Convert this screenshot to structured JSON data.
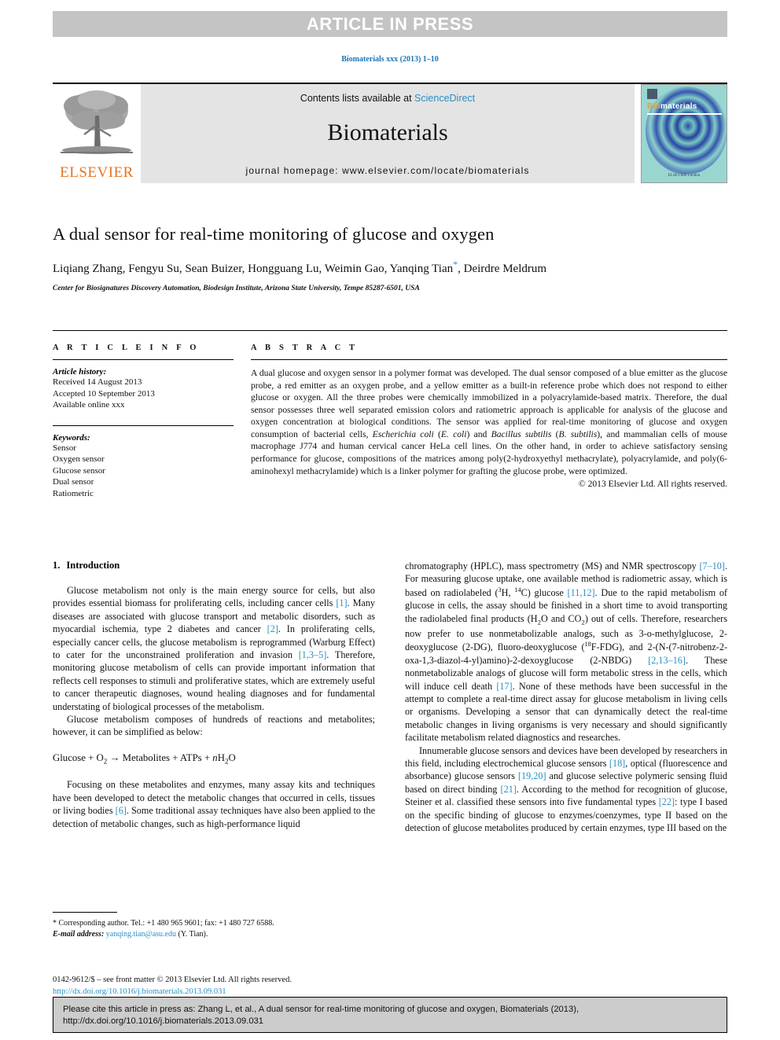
{
  "banner": {
    "label": "ARTICLE IN PRESS"
  },
  "running_head": "Biomaterials xxx (2013) 1–10",
  "masthead": {
    "publisher_logo_text": "ELSEVIER",
    "contents_prefix": "Contents lists available at ",
    "contents_link": "ScienceDirect",
    "journal_name": "Biomaterials",
    "homepage_line": "journal homepage: www.elsevier.com/locate/biomaterials",
    "cover": {
      "title_first": "Bio",
      "title_rest": "materials",
      "footer": "ELSEVIER\nLondon"
    }
  },
  "article": {
    "title": "A dual sensor for real-time monitoring of glucose and oxygen",
    "authors": "Liqiang Zhang, Fengyu Su, Sean Buizer, Hongguang Lu, Weimin Gao, Yanqing Tian",
    "corresponding_marker": "*",
    "authors_tail": ", Deirdre Meldrum",
    "affiliation": "Center for Biosignatures Discovery Automation, Biodesign Institute, Arizona State University, Tempe 85287-6501, USA"
  },
  "article_info": {
    "heading": "A R T I C L E   I N F O",
    "history_label": "Article history:",
    "history_lines": [
      "Received 14 August 2013",
      "Accepted 10 September 2013",
      "Available online xxx"
    ],
    "keywords_label": "Keywords:",
    "keywords": [
      "Sensor",
      "Oxygen sensor",
      "Glucose sensor",
      "Dual sensor",
      "Ratiometric"
    ]
  },
  "abstract": {
    "heading": "A B S T R A C T",
    "part1": "A dual glucose and oxygen sensor in a polymer format was developed. The dual sensor composed of a blue emitter as the glucose probe, a red emitter as an oxygen probe, and a yellow emitter as a built-in reference probe which does not respond to either glucose or oxygen. All the three probes were chemically immobilized in a polyacrylamide-based matrix. Therefore, the dual sensor possesses three well separated emission colors and ratiometric approach is applicable for analysis of the glucose and oxygen concentration at biological conditions. The sensor was applied for real-time monitoring of glucose and oxygen consumption of bacterial cells, ",
    "italic1": "Escherichia coli",
    "part2": " (",
    "italic2": "E. coli",
    "part3": ") and ",
    "italic3": "Bacillus subtilis",
    "part4": " (",
    "italic4": "B. subtilis",
    "part5": "), and mammalian cells of mouse macrophage J774 and human cervical cancer HeLa cell lines. On the other hand, in order to achieve satisfactory sensing performance for glucose, compositions of the matrices among poly(2-hydroxyethyl methacrylate), polyacrylamide, and poly(6-aminohexyl methacrylamide) which is a linker polymer for grafting the glucose probe, were optimized.",
    "copyright": "© 2013 Elsevier Ltd. All rights reserved."
  },
  "body": {
    "section_number": "1.",
    "section_title": "Introduction",
    "left_column": {
      "p1_a": "Glucose metabolism not only is the main energy source for cells, but also provides essential biomass for proliferating cells, including cancer cells ",
      "p1_r1": "[1]",
      "p1_b": ". Many diseases are associated with glucose transport and metabolic disorders, such as myocardial ischemia, type 2 diabetes and cancer ",
      "p1_r2": "[2]",
      "p1_c": ". In proliferating cells, especially cancer cells, the glucose metabolism is reprogrammed (Warburg Effect) to cater for the unconstrained proliferation and invasion ",
      "p1_r3": "[1,3–5]",
      "p1_d": ". Therefore, monitoring glucose metabolism of cells can provide important information that reflects cell responses to stimuli and proliferative states, which are extremely useful to cancer therapeutic diagnoses, wound healing diagnoses and for fundamental understating of biological processes of the metabolism.",
      "p2": "Glucose metabolism composes of hundreds of reactions and metabolites; however, it can be simplified as below:",
      "equation_parts": {
        "a": "Glucose + O",
        "sub1": "2",
        "b": " → Metabolites + ATPs + ",
        "italic_n": "n",
        "c": "H",
        "sub2": "2",
        "d": "O"
      },
      "p3_a": "Focusing on these metabolites and enzymes, many assay kits and techniques have been developed to detect the metabolic changes that occurred in cells, tissues or living bodies ",
      "p3_r1": "[6]",
      "p3_b": ". Some traditional assay techniques have also been applied to the detection of metabolic changes, such as high-performance liquid"
    },
    "right_column": {
      "p1_a": "chromatography (HPLC), mass spectrometry (MS) and NMR spectroscopy ",
      "p1_r1": "[7–10]",
      "p1_b": ". For measuring glucose uptake, one available method is radiometric assay, which is based on radiolabeled (",
      "p1_sup1": "3",
      "p1_c": "H, ",
      "p1_sup2": "14",
      "p1_d": "C) glucose ",
      "p1_r2": "[11,12]",
      "p1_e": ". Due to the rapid metabolism of glucose in cells, the assay should be finished in a short time to avoid transporting the radiolabeled final products (H",
      "p1_sub1": "2",
      "p1_f": "O and CO",
      "p1_sub2": "2",
      "p1_g": ") out of cells. Therefore, researchers now prefer to use nonmetabolizable analogs, such as 3-o-methylglucose, 2-deoxyglucose (2-DG), fluoro-deoxyglucose (",
      "p1_sup3": "18",
      "p1_h": "F-FDG), and 2-(N-(7-nitrobenz-2-oxa-1,3-diazol-4-yl)amino)-2-dexoyglucose (2-NBDG) ",
      "p1_r3": "[2,13–16]",
      "p1_i": ". These nonmetabolizable analogs of glucose will form metabolic stress in the cells, which will induce cell death ",
      "p1_r4": "[17]",
      "p1_j": ". None of these methods have been successful in the attempt to complete a real-time direct assay for glucose metabolism in living cells or organisms. Developing a sensor that can dynamically detect the real-time metabolic changes in living organisms is very necessary and should significantly facilitate metabolism related diagnostics and researches.",
      "p2_a": "Innumerable glucose sensors and devices have been developed by researchers in this field, including electrochemical glucose sensors ",
      "p2_r1": "[18]",
      "p2_b": ", optical (fluorescence and absorbance) glucose sensors ",
      "p2_r2": "[19,20]",
      "p2_c": " and glucose selective polymeric sensing fluid based on direct binding ",
      "p2_r3": "[21]",
      "p2_d": ". According to the method for recognition of glucose, Steiner et al. classified these sensors into five fundamental types ",
      "p2_r4": "[22]",
      "p2_e": ": type I based on the specific binding of glucose to enzymes/coenzymes, type II based on the detection of glucose metabolites produced by certain enzymes, type III based on the"
    }
  },
  "footnote": {
    "corresponding": "* Corresponding author. Tel.: +1 480 965 9601; fax: +1 480 727 6588.",
    "email_label": "E-mail address:",
    "email": "yanqing.tian@asu.edu",
    "email_suffix": "(Y. Tian)."
  },
  "frontmatter": {
    "line1": "0142-9612/$ – see front matter © 2013 Elsevier Ltd. All rights reserved.",
    "doi": "http://dx.doi.org/10.1016/j.biomaterials.2013.09.031"
  },
  "cite_box": {
    "text": "Please cite this article in press as: Zhang L, et al., A dual sensor for real-time monitoring of glucose and oxygen, Biomaterials (2013), http://dx.doi.org/10.1016/j.biomaterials.2013.09.031"
  }
}
